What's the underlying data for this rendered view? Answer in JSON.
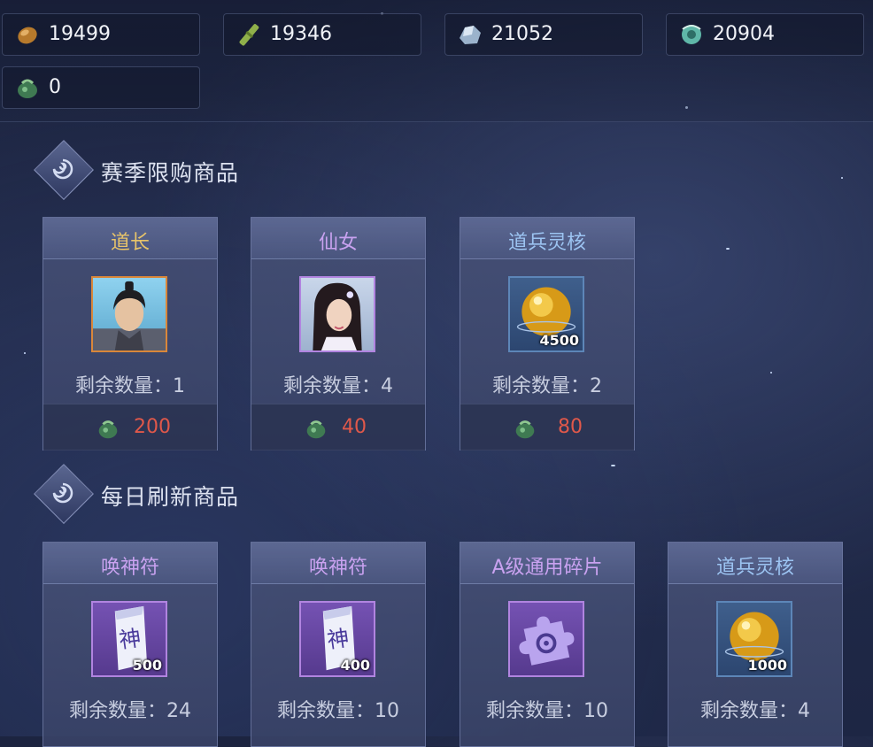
{
  "currencies": [
    {
      "icon": "ore-icon",
      "value": "19499"
    },
    {
      "icon": "bamboo-icon",
      "value": "19346"
    },
    {
      "icon": "crystal-icon",
      "value": "21052"
    },
    {
      "icon": "jade-icon",
      "value": "20904"
    },
    {
      "icon": "jade-pouch-icon",
      "value": "0"
    }
  ],
  "sections": {
    "season": {
      "title": "赛季限购商品",
      "items": [
        {
          "name": "道长",
          "name_color": "#e8c46a",
          "qty": "剩余数量：1",
          "price": "200",
          "image": "taoist-portrait-icon"
        },
        {
          "name": "仙女",
          "name_color": "#c9a2f0",
          "qty": "剩余数量：4",
          "price": "40",
          "image": "fairy-portrait-icon"
        },
        {
          "name": "道兵灵核",
          "name_color": "#9cc4f2",
          "qty": "剩余数量：2",
          "price": "80",
          "image": "golden-orb-icon",
          "badge": "4500"
        }
      ]
    },
    "daily": {
      "title": "每日刷新商品",
      "items": [
        {
          "name": "唤神符",
          "name_color": "#c9a2f0",
          "qty": "剩余数量：24",
          "image": "talisman-icon",
          "badge": "500"
        },
        {
          "name": "唤神符",
          "name_color": "#c9a2f0",
          "qty": "剩余数量：10",
          "image": "talisman-icon",
          "badge": "400"
        },
        {
          "name": "A级通用碎片",
          "name_color": "#c9a2f0",
          "qty": "剩余数量：10",
          "image": "puzzle-shard-icon"
        },
        {
          "name": "道兵灵核",
          "name_color": "#9cc4f2",
          "qty": "剩余数量：4",
          "image": "golden-orb-icon",
          "badge": "1000"
        }
      ]
    }
  },
  "talisman_glyph": "神",
  "colors": {
    "price": "#e0584a",
    "gold_name": "#e8c46a",
    "purple_name": "#c9a2f0",
    "blue_name": "#9cc4f2"
  }
}
